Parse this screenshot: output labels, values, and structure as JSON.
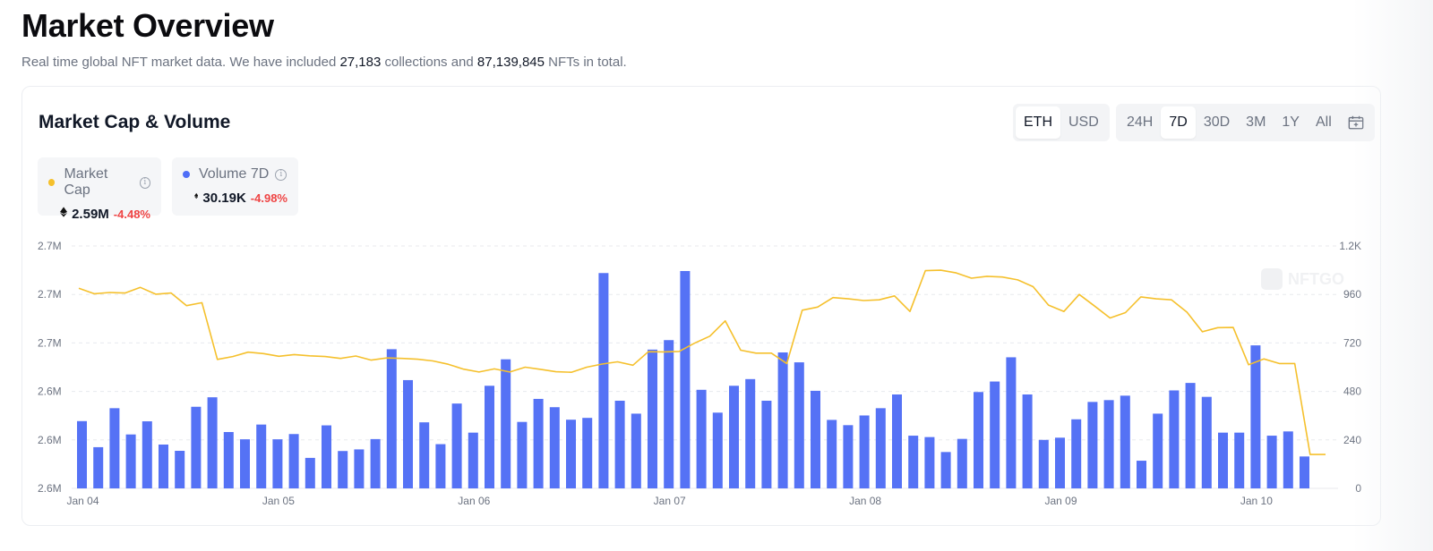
{
  "header": {
    "title": "Market Overview",
    "subtitle_pre": "Real time global NFT market data. We have included ",
    "collections": "27,183",
    "subtitle_mid": " collections and ",
    "nfts": "87,139,845",
    "subtitle_post": " NFTs in total."
  },
  "card": {
    "title": "Market Cap & Volume",
    "currency_options": [
      "ETH",
      "USD"
    ],
    "currency_selected": "ETH",
    "range_options": [
      "24H",
      "7D",
      "30D",
      "3M",
      "1Y",
      "All"
    ],
    "range_selected": "7D",
    "legend": [
      {
        "label": "Market Cap",
        "value": "2.59M",
        "change": "-4.48%",
        "color": "#f5c02c"
      },
      {
        "label": "Volume 7D",
        "value": "30.19K",
        "change": "-4.98%",
        "color": "#4f6ef7"
      }
    ],
    "watermark": "NFTGO"
  },
  "colors": {
    "bar": "#5572f5",
    "line": "#f5c02c",
    "negative": "#ef4444",
    "grid": "#e8eaee"
  },
  "chart_data": {
    "type": "bar",
    "x": [
      "Jan 04",
      "",
      "",
      "",
      "",
      "",
      "",
      "",
      "",
      "",
      "",
      "",
      "Jan 05",
      "",
      "",
      "",
      "",
      "",
      "",
      "",
      "",
      "",
      "",
      "",
      "Jan 06",
      "",
      "",
      "",
      "",
      "",
      "",
      "",
      "",
      "",
      "",
      "",
      "Jan 07",
      "",
      "",
      "",
      "",
      "",
      "",
      "",
      "",
      "",
      "",
      "",
      "Jan 08",
      "",
      "",
      "",
      "",
      "",
      "",
      "",
      "",
      "",
      "",
      "",
      "Jan 09",
      "",
      "",
      "",
      "",
      "",
      "",
      "",
      "",
      "",
      "",
      "",
      "Jan 10",
      "",
      "",
      ""
    ],
    "xticks": [
      "Jan 04",
      "Jan 05",
      "Jan 06",
      "Jan 07",
      "Jan 08",
      "Jan 09",
      "Jan 10"
    ],
    "left_ticks": [
      "2.6M",
      "2.6M",
      "2.6M",
      "2.7M",
      "2.7M",
      "2.7M"
    ],
    "right_ticks": [
      "0",
      "240",
      "480",
      "720",
      "960",
      "1.2K"
    ],
    "right_ylim": [
      0,
      1200
    ],
    "series": [
      {
        "name": "Volume 7D",
        "axis": "right",
        "type": "bar",
        "values": [
          333,
          204,
          397,
          267,
          332,
          217,
          186,
          404,
          451,
          279,
          243,
          316,
          243,
          269,
          151,
          312,
          185,
          193,
          244,
          689,
          536,
          327,
          219,
          420,
          276,
          508,
          639,
          329,
          443,
          402,
          340,
          349,
          1066,
          434,
          370,
          687,
          734,
          1076,
          488,
          375,
          508,
          541,
          434,
          673,
          624,
          483,
          339,
          313,
          361,
          397,
          465,
          261,
          254,
          180,
          245,
          477,
          529,
          649,
          465,
          240,
          251,
          342,
          428,
          437,
          459,
          137,
          370,
          485,
          522,
          453,
          276,
          276,
          708,
          261,
          282,
          158
        ],
        "color": "#5572f5"
      },
      {
        "name": "Market Cap",
        "axis": "left",
        "type": "line",
        "values_normalized": [
          0.826,
          0.803,
          0.808,
          0.806,
          0.829,
          0.801,
          0.806,
          0.754,
          0.766,
          0.532,
          0.544,
          0.562,
          0.556,
          0.545,
          0.552,
          0.547,
          0.544,
          0.536,
          0.546,
          0.529,
          0.538,
          0.536,
          0.533,
          0.526,
          0.512,
          0.492,
          0.48,
          0.493,
          0.48,
          0.5,
          0.491,
          0.481,
          0.479,
          0.5,
          0.513,
          0.522,
          0.508,
          0.564,
          0.563,
          0.565,
          0.599,
          0.628,
          0.691,
          0.57,
          0.558,
          0.558,
          0.515,
          0.735,
          0.748,
          0.787,
          0.782,
          0.775,
          0.778,
          0.794,
          0.73,
          0.898,
          0.9,
          0.889,
          0.867,
          0.875,
          0.872,
          0.86,
          0.832,
          0.756,
          0.73,
          0.8,
          0.752,
          0.703,
          0.725,
          0.79,
          0.782,
          0.778,
          0.727,
          0.646,
          0.663,
          0.664,
          0.51,
          0.534,
          0.515,
          0.515,
          0.14,
          0.14
        ],
        "color": "#f5c02c"
      }
    ]
  }
}
